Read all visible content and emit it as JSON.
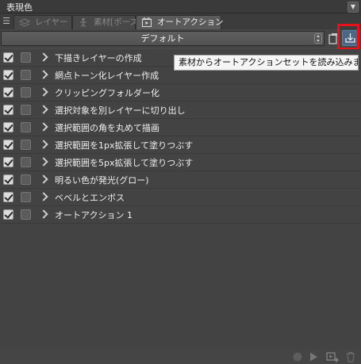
{
  "panel": {
    "title": "表現色",
    "collapse_icon": "chevron-down-icon"
  },
  "tabs": [
    {
      "label": "レイヤー",
      "icon": "layer-icon",
      "active": false
    },
    {
      "label": "素材[ポーズ]",
      "icon": "pose-figure-icon",
      "active": false
    },
    {
      "label": "オートアクション",
      "icon": "auto-action-icon",
      "active": true
    }
  ],
  "toolbar": {
    "preset_value": "デフォルト",
    "copy_icon": "copy-set-icon",
    "import_icon": "import-download-icon"
  },
  "tooltip": {
    "text": "素材からオートアクションセットを読み込みます"
  },
  "actions": [
    {
      "label": "下描きレイヤーの作成",
      "enabled": true
    },
    {
      "label": "網点トーン化レイヤー作成",
      "enabled": true
    },
    {
      "label": "クリッピングフォルダー化",
      "enabled": true
    },
    {
      "label": "選択対象を別レイヤーに切り出し",
      "enabled": true
    },
    {
      "label": "選択範囲の角を丸めて描画",
      "enabled": true
    },
    {
      "label": "選択範囲を1px拡張して塗りつぶす",
      "enabled": true
    },
    {
      "label": "選択範囲を5px拡張して塗りつぶす",
      "enabled": true
    },
    {
      "label": "明るい色が発光(グロー)",
      "enabled": true
    },
    {
      "label": "ベベルとエンボス",
      "enabled": true
    },
    {
      "label": "オートアクション 1",
      "enabled": true
    }
  ],
  "bottom_bar": {
    "icons": [
      "record-icon",
      "play-icon",
      "new-action-icon",
      "delete-icon"
    ]
  },
  "colors": {
    "highlight": "#e8111a",
    "import_button": "#4d6684"
  }
}
